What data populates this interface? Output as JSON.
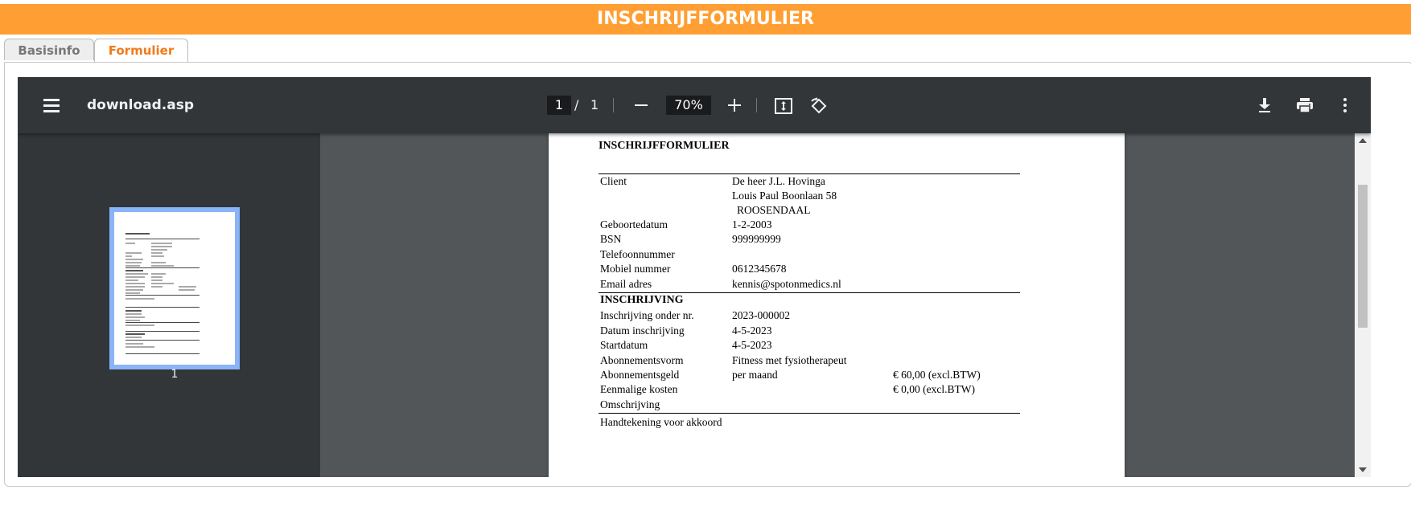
{
  "header": {
    "title": "INSCHRIJFFORMULIER",
    "color": "#ff9f33"
  },
  "tabs": [
    {
      "label": "Basisinfo",
      "active": false
    },
    {
      "label": "Formulier",
      "active": true
    }
  ],
  "viewer": {
    "filename": "download.asp",
    "page_current": "1",
    "page_separator": "/",
    "page_total": "1",
    "zoom": "70%",
    "thumbnail_label": "1",
    "icons": [
      "menu-icon",
      "zoom-out-icon",
      "zoom-in-icon",
      "fit-to-page-icon",
      "rotate-icon",
      "download-icon",
      "print-icon",
      "more-options-icon"
    ]
  },
  "document": {
    "title": "INSCHRIJFFORMULIER",
    "client": {
      "label": "Client",
      "name": "De heer J.L. Hovinga",
      "address": "Louis Paul Boonlaan 58",
      "city": "ROOSENDAAL"
    },
    "fields": [
      {
        "label": "Geboortedatum",
        "value": "1-2-2003"
      },
      {
        "label": "BSN",
        "value": "999999999"
      },
      {
        "label": "Telefoonnummer",
        "value": ""
      },
      {
        "label": "Mobiel nummer",
        "value": "0612345678"
      },
      {
        "label": "Email adres",
        "value": "kennis@spotonmedics.nl"
      }
    ],
    "section_inschrijving": "INSCHRIJVING",
    "inschrijving": [
      {
        "label": "Inschrijving onder nr.",
        "value": "2023-000002",
        "amount": ""
      },
      {
        "label": "Datum inschrijving",
        "value": "4-5-2023",
        "amount": ""
      },
      {
        "label": "Startdatum",
        "value": "4-5-2023",
        "amount": ""
      },
      {
        "label": "Abonnementsvorm",
        "value": "Fitness met fysiotherapeut",
        "amount": ""
      },
      {
        "label": "Abonnementsgeld",
        "value": "per maand",
        "amount": "€ 60,00 (excl.BTW)"
      },
      {
        "label": "Eenmalige kosten",
        "value": "",
        "amount": "€ 0,00 (excl.BTW)"
      },
      {
        "label": "Omschrijving",
        "value": "",
        "amount": ""
      }
    ],
    "signature_label": "Handtekening voor akkoord"
  }
}
